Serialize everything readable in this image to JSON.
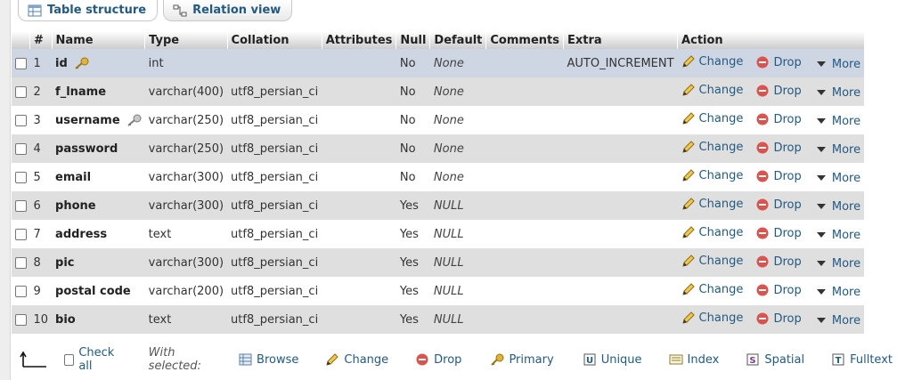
{
  "tabs": [
    {
      "label": "Table structure"
    },
    {
      "label": "Relation view"
    }
  ],
  "columns": [
    "#",
    "Name",
    "Type",
    "Collation",
    "Attributes",
    "Null",
    "Default",
    "Comments",
    "Extra",
    "Action"
  ],
  "rows": [
    {
      "num": "1",
      "name": "id",
      "type": "int",
      "collation": "",
      "attributes": "",
      "null": "No",
      "default": "None",
      "comments": "",
      "extra": "AUTO_INCREMENT",
      "key": "primary"
    },
    {
      "num": "2",
      "name": "f_lname",
      "type": "varchar(400)",
      "collation": "utf8_persian_ci",
      "attributes": "",
      "null": "No",
      "default": "None",
      "comments": "",
      "extra": "",
      "key": ""
    },
    {
      "num": "3",
      "name": "username",
      "type": "varchar(250)",
      "collation": "utf8_persian_ci",
      "attributes": "",
      "null": "No",
      "default": "None",
      "comments": "",
      "extra": "",
      "key": "unique"
    },
    {
      "num": "4",
      "name": "password",
      "type": "varchar(250)",
      "collation": "utf8_persian_ci",
      "attributes": "",
      "null": "No",
      "default": "None",
      "comments": "",
      "extra": "",
      "key": ""
    },
    {
      "num": "5",
      "name": "email",
      "type": "varchar(300)",
      "collation": "utf8_persian_ci",
      "attributes": "",
      "null": "No",
      "default": "None",
      "comments": "",
      "extra": "",
      "key": ""
    },
    {
      "num": "6",
      "name": "phone",
      "type": "varchar(300)",
      "collation": "utf8_persian_ci",
      "attributes": "",
      "null": "Yes",
      "default": "NULL",
      "comments": "",
      "extra": "",
      "key": ""
    },
    {
      "num": "7",
      "name": "address",
      "type": "text",
      "collation": "utf8_persian_ci",
      "attributes": "",
      "null": "Yes",
      "default": "NULL",
      "comments": "",
      "extra": "",
      "key": ""
    },
    {
      "num": "8",
      "name": "pic",
      "type": "varchar(300)",
      "collation": "utf8_persian_ci",
      "attributes": "",
      "null": "Yes",
      "default": "NULL",
      "comments": "",
      "extra": "",
      "key": ""
    },
    {
      "num": "9",
      "name": "postal code",
      "type": "varchar(200)",
      "collation": "utf8_persian_ci",
      "attributes": "",
      "null": "Yes",
      "default": "NULL",
      "comments": "",
      "extra": "",
      "key": ""
    },
    {
      "num": "10",
      "name": "bio",
      "type": "text",
      "collation": "utf8_persian_ci",
      "attributes": "",
      "null": "Yes",
      "default": "NULL",
      "comments": "",
      "extra": "",
      "key": ""
    }
  ],
  "row_actions": {
    "change": "Change",
    "drop": "Drop",
    "more": "More"
  },
  "footer": {
    "check_all": "Check all",
    "with_selected": "With selected:",
    "browse": "Browse",
    "change": "Change",
    "drop": "Drop",
    "primary": "Primary",
    "unique": "Unique",
    "index": "Index",
    "spatial": "Spatial",
    "fulltext": "Fulltext"
  },
  "colors": {
    "link": "#235a81",
    "selected_row": "#ced6e3",
    "alt_row": "#dfdfdf",
    "drop_red": "#d9534f",
    "key_gold": "#e0b43a"
  }
}
